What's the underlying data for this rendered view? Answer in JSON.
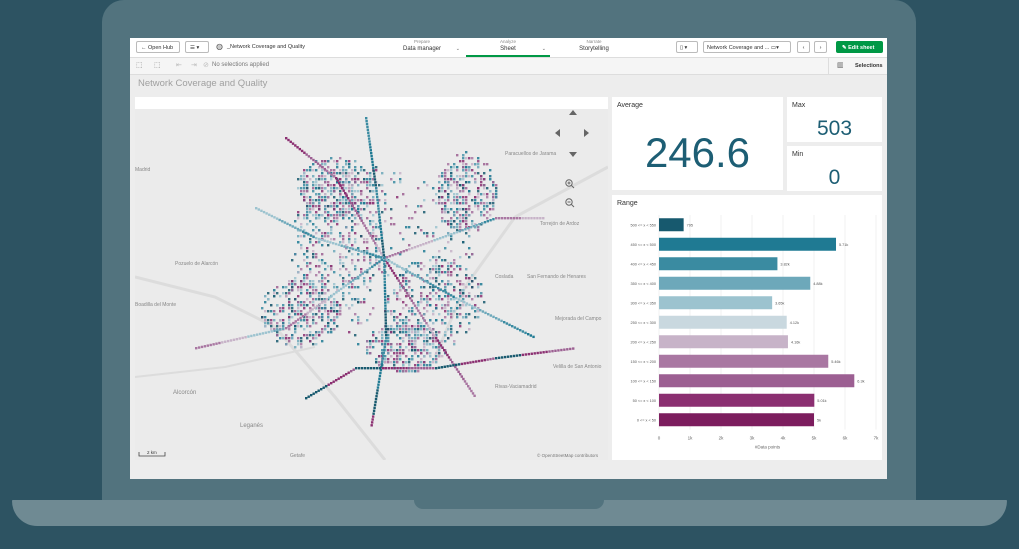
{
  "topbar": {
    "open_hub": "Open Hub",
    "app_name": "_Network Coverage and Quality",
    "nav": [
      {
        "category": "Prepare",
        "name": "Data manager"
      },
      {
        "category": "Analyze",
        "name": "Sheet"
      },
      {
        "category": "Narrate",
        "name": "Storytelling"
      }
    ],
    "sheet_select": "Network Coverage and ...",
    "edit_sheet": "Edit sheet"
  },
  "selection_bar": {
    "status": "No selections applied",
    "selections": "Selections"
  },
  "sheet_title": "Network Coverage and Quality",
  "map": {
    "places": [
      "Paracuellos de Jarama",
      "Torrejón de Ardoz",
      "San Fernando de Henares",
      "Coslada",
      "Mejorada del Campo",
      "Velilla de San Antonio",
      "Rivas-Vaciamadrid",
      "Alcorcón",
      "Leganés",
      "Getafe",
      "Madrid",
      "Pozuelo de Alarcón",
      "Boadilla del Monte"
    ],
    "scale": "2 km",
    "attribution": "© OpenStreetMap contributors"
  },
  "kpis": {
    "average": {
      "label": "Average",
      "value": "246.6"
    },
    "max": {
      "label": "Max",
      "value": "503"
    },
    "min": {
      "label": "Min",
      "value": "0"
    }
  },
  "chart_data": {
    "type": "bar",
    "title": "Range",
    "xlabel": "#Data points",
    "orientation": "horizontal",
    "categories": [
      "500 <= x < 550",
      "450 <= x < 500",
      "400 <= x < 450",
      "350 <= x < 400",
      "300 <= x < 350",
      "250 <= x < 300",
      "200 <= x < 250",
      "150 <= x < 200",
      "100 <= x < 150",
      "50 <= x < 100",
      "0 <= x < 50"
    ],
    "values": [
      795,
      5710,
      3820,
      4880,
      3650,
      4120,
      4160,
      5460,
      6300,
      5010,
      5000
    ],
    "data_labels": [
      "795",
      "5.71k",
      "3.82k",
      "4.88k",
      "3.65k",
      "4.12k",
      "4.16k",
      "5.46k",
      "6.3k",
      "5.01k",
      "5k"
    ],
    "colors": [
      "#17596e",
      "#1f7a93",
      "#3a8ba1",
      "#6da8ba",
      "#9cc3cf",
      "#c9d8df",
      "#c7b3c8",
      "#a977a2",
      "#9c5f92",
      "#8b2f71",
      "#7c1d5e"
    ],
    "xticks": [
      "0",
      "1k",
      "2k",
      "3k",
      "4k",
      "5k",
      "6k",
      "7k"
    ],
    "xlim": [
      0,
      7000
    ],
    "grid": true
  }
}
